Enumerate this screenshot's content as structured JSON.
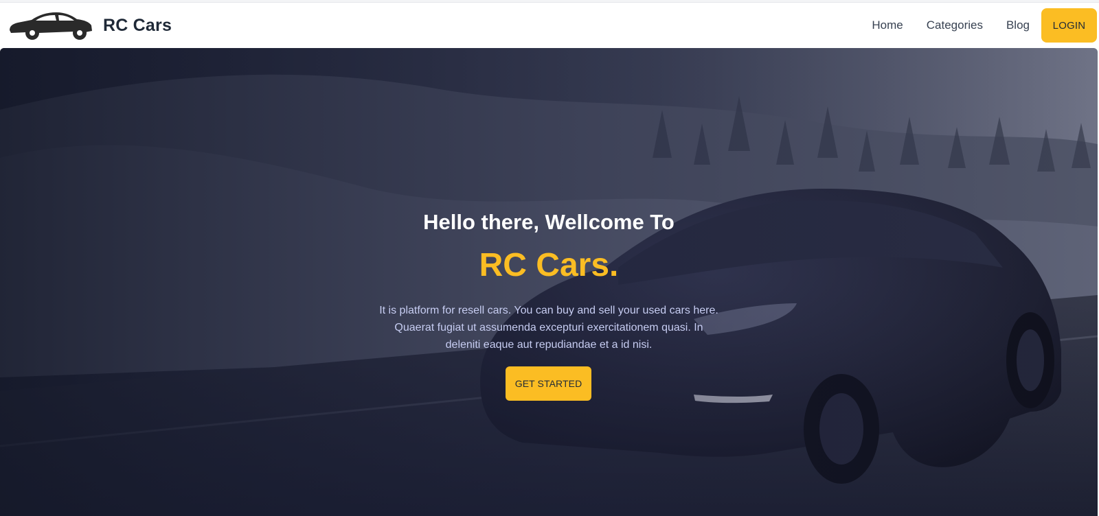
{
  "brand": {
    "name": "RC Cars",
    "logo_icon": "car-silhouette-icon"
  },
  "nav": {
    "items": [
      {
        "label": "Home"
      },
      {
        "label": "Categories"
      },
      {
        "label": "Blog"
      }
    ],
    "login_label": "LOGIN"
  },
  "hero": {
    "greeting": "Hello there, Wellcome To",
    "title": "RC Cars.",
    "description": "It is platform for resell cars. You can buy and sell your used cars here. Quaerat fugiat ut assumenda excepturi exercitationem quasi. In deleniti eaque aut repudiandae et a id nisi.",
    "cta_label": "GET STARTED",
    "background_image": "snowy-road-black-car-photo"
  },
  "colors": {
    "accent": "#fbbd23",
    "text_dark": "#1f2937",
    "hero_overlay": "#1b1f3a",
    "hero_text": "#c7cdf2"
  }
}
